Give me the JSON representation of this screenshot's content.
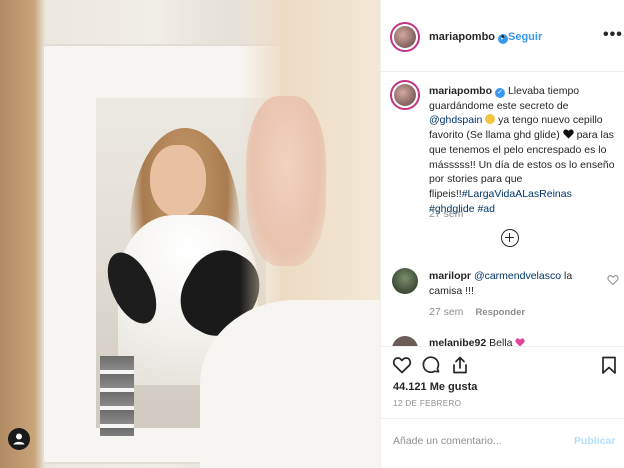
{
  "post": {
    "username": "mariapombo",
    "verified_icon": "verified-check-icon",
    "separator": "•",
    "follow_label": "Seguir",
    "more_label": "•••"
  },
  "caption": {
    "username": "mariapombo",
    "text_1": "Llevaba tiempo guardándome este secreto de ",
    "mention_1": "@ghdspain",
    "text_2": " ya tengo nuevo cepillo favorito (Se llama ghd glide) ",
    "text_3": " para las que tenemos el pelo encrespado es lo másssss!! Un día de estos os lo enseño por stories para que flipeis!!",
    "hashtags": "#LargaVidaALasReinas #ghdglide #ad",
    "time": "27 sem"
  },
  "comments": [
    {
      "username": "marilopr",
      "mention": "@carmendvelasco",
      "text": " la camisa !!!",
      "time": "27 sem",
      "reply_label": "Responder"
    },
    {
      "username": "melanibe92",
      "text": " Bella"
    }
  ],
  "actions": {
    "likes": "44.121 Me gusta",
    "date": "12 DE FEBRERO"
  },
  "add_comment": {
    "placeholder": "Añade un comentario...",
    "publish_label": "Publicar"
  },
  "colors": {
    "link_blue": "#3897f0",
    "mention_blue": "#003569",
    "muted_gray": "#8e8e8e",
    "publish_disabled": "#b2dffc"
  }
}
